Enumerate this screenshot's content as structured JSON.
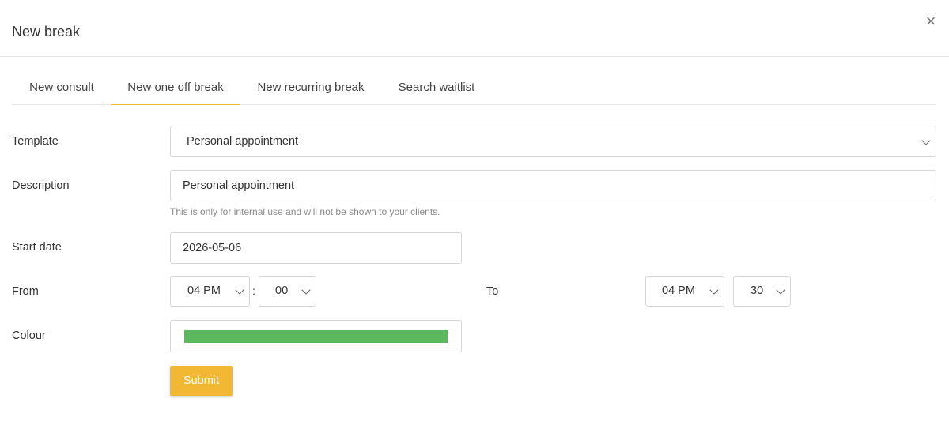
{
  "modal": {
    "title": "New break",
    "close_icon": "×"
  },
  "tabs": [
    {
      "label": "New consult",
      "active": false
    },
    {
      "label": "New one off break",
      "active": true
    },
    {
      "label": "New recurring break",
      "active": false
    },
    {
      "label": "Search waitlist",
      "active": false
    }
  ],
  "form": {
    "template": {
      "label": "Template",
      "value": "Personal appointment"
    },
    "description": {
      "label": "Description",
      "value": "Personal appointment",
      "help": "This is only for internal use and will not be shown to your clients."
    },
    "start_date": {
      "label": "Start date",
      "value": "2026-05-06"
    },
    "from": {
      "label": "From",
      "hour": "04 PM",
      "minute": "00"
    },
    "to": {
      "label": "To",
      "hour": "04 PM",
      "minute": "30"
    },
    "time_separator": ":",
    "colour": {
      "label": "Colour",
      "value": "#5cb85c"
    },
    "submit_label": "Submit"
  },
  "colors": {
    "accent": "#f2b833",
    "selected_colour": "#5cb85c"
  }
}
